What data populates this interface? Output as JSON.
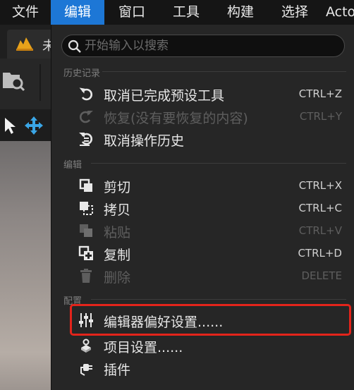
{
  "menubar": {
    "items": [
      "文件",
      "编辑",
      "窗口",
      "工具",
      "构建",
      "选择",
      "Acto"
    ],
    "active": "编辑"
  },
  "background": {
    "tab_label": "未"
  },
  "search": {
    "placeholder": "开始输入以搜索",
    "value": ""
  },
  "sections": {
    "history": "历史记录",
    "edit": "编辑",
    "config": "配置"
  },
  "history_items": [
    {
      "label": "取消已完成预设工具",
      "shortcut": "CTRL+Z",
      "enabled": true,
      "icon": "undo-icon"
    },
    {
      "label": "恢复(没有要恢复的内容)",
      "shortcut": "CTRL+Y",
      "enabled": false,
      "icon": "redo-icon"
    },
    {
      "label": "取消操作历史",
      "shortcut": "",
      "enabled": true,
      "icon": "undo-history-icon"
    }
  ],
  "edit_items": [
    {
      "label": "剪切",
      "shortcut": "CTRL+X",
      "enabled": true,
      "icon": "cut-icon"
    },
    {
      "label": "拷贝",
      "shortcut": "CTRL+C",
      "enabled": true,
      "icon": "copy-icon"
    },
    {
      "label": "粘贴",
      "shortcut": "CTRL+V",
      "enabled": false,
      "icon": "paste-icon"
    },
    {
      "label": "复制",
      "shortcut": "CTRL+D",
      "enabled": true,
      "icon": "duplicate-icon"
    },
    {
      "label": "删除",
      "shortcut": "DELETE",
      "enabled": false,
      "icon": "delete-icon"
    }
  ],
  "config_items": [
    {
      "label": "编辑器偏好设置......",
      "shortcut": "",
      "enabled": true,
      "icon": "sliders-icon"
    },
    {
      "label": "项目设置......",
      "shortcut": "",
      "enabled": true,
      "icon": "project-settings-icon"
    },
    {
      "label": "插件",
      "shortcut": "",
      "enabled": true,
      "icon": "plugin-icon"
    }
  ],
  "colors": {
    "accent": "#1d77d6",
    "highlight_box": "#e3241b",
    "menu_bg": "#262626"
  }
}
